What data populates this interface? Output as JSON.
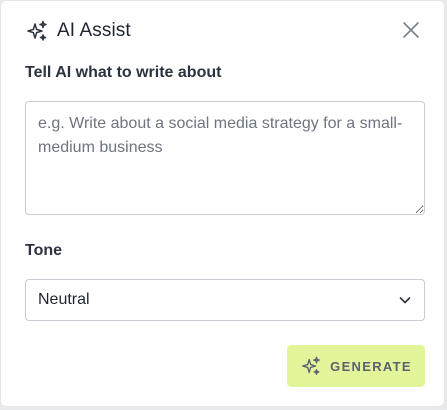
{
  "dialog": {
    "title": "AI Assist",
    "close_icon": "close-icon",
    "title_icon": "sparkles-icon"
  },
  "prompt": {
    "label": "Tell AI what to write about",
    "value": "",
    "placeholder": "e.g. Write about a social media strategy for a small-medium business"
  },
  "tone": {
    "label": "Tone",
    "selected": "Neutral",
    "icon": "chevron-down-icon"
  },
  "generate": {
    "label": "GENERATE",
    "icon": "sparkles-icon",
    "background": "#e3f59b"
  }
}
